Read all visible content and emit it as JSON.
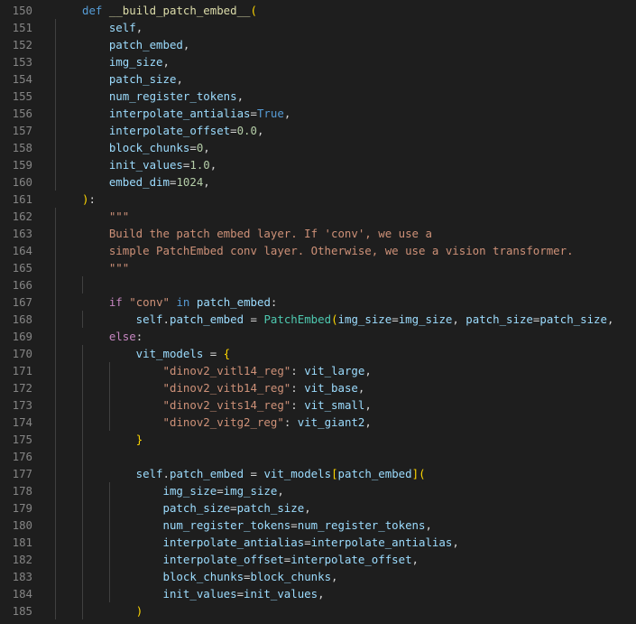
{
  "editor": {
    "lines": [
      {
        "n": "150",
        "tokens": [
          {
            "t": "def",
            "c": "kw"
          },
          {
            "t": " ",
            "c": "pl"
          },
          {
            "t": "__build_patch_embed__",
            "c": "fn"
          },
          {
            "t": "(",
            "c": "b1"
          }
        ]
      },
      {
        "n": "151",
        "tokens": [
          {
            "t": "    self",
            "c": "var"
          },
          {
            "t": ",",
            "c": "pl"
          }
        ]
      },
      {
        "n": "152",
        "tokens": [
          {
            "t": "    patch_embed",
            "c": "var"
          },
          {
            "t": ",",
            "c": "pl"
          }
        ]
      },
      {
        "n": "153",
        "tokens": [
          {
            "t": "    img_size",
            "c": "var"
          },
          {
            "t": ",",
            "c": "pl"
          }
        ]
      },
      {
        "n": "154",
        "tokens": [
          {
            "t": "    patch_size",
            "c": "var"
          },
          {
            "t": ",",
            "c": "pl"
          }
        ]
      },
      {
        "n": "155",
        "tokens": [
          {
            "t": "    num_register_tokens",
            "c": "var"
          },
          {
            "t": ",",
            "c": "pl"
          }
        ]
      },
      {
        "n": "156",
        "tokens": [
          {
            "t": "    interpolate_antialias",
            "c": "var"
          },
          {
            "t": "=",
            "c": "op"
          },
          {
            "t": "True",
            "c": "kw"
          },
          {
            "t": ",",
            "c": "pl"
          }
        ]
      },
      {
        "n": "157",
        "tokens": [
          {
            "t": "    interpolate_offset",
            "c": "var"
          },
          {
            "t": "=",
            "c": "op"
          },
          {
            "t": "0.0",
            "c": "num"
          },
          {
            "t": ",",
            "c": "pl"
          }
        ]
      },
      {
        "n": "158",
        "tokens": [
          {
            "t": "    block_chunks",
            "c": "var"
          },
          {
            "t": "=",
            "c": "op"
          },
          {
            "t": "0",
            "c": "num"
          },
          {
            "t": ",",
            "c": "pl"
          }
        ]
      },
      {
        "n": "159",
        "tokens": [
          {
            "t": "    init_values",
            "c": "var"
          },
          {
            "t": "=",
            "c": "op"
          },
          {
            "t": "1.0",
            "c": "num"
          },
          {
            "t": ",",
            "c": "pl"
          }
        ]
      },
      {
        "n": "160",
        "tokens": [
          {
            "t": "    embed_dim",
            "c": "var"
          },
          {
            "t": "=",
            "c": "op"
          },
          {
            "t": "1024",
            "c": "num"
          },
          {
            "t": ",",
            "c": "pl"
          }
        ]
      },
      {
        "n": "161",
        "tokens": [
          {
            "t": ")",
            "c": "b1"
          },
          {
            "t": ":",
            "c": "pl"
          }
        ]
      },
      {
        "n": "162",
        "tokens": [
          {
            "t": "    \"\"\"",
            "c": "str"
          }
        ]
      },
      {
        "n": "163",
        "tokens": [
          {
            "t": "    Build the patch embed layer. If 'conv', we use a",
            "c": "str"
          }
        ]
      },
      {
        "n": "164",
        "tokens": [
          {
            "t": "    simple PatchEmbed conv layer. Otherwise, we use a vision transformer.",
            "c": "str"
          }
        ]
      },
      {
        "n": "165",
        "tokens": [
          {
            "t": "    \"\"\"",
            "c": "str"
          }
        ]
      },
      {
        "n": "166",
        "tokens": []
      },
      {
        "n": "167",
        "tokens": [
          {
            "t": "    ",
            "c": "pl"
          },
          {
            "t": "if",
            "c": "ctl"
          },
          {
            "t": " ",
            "c": "pl"
          },
          {
            "t": "\"conv\"",
            "c": "str"
          },
          {
            "t": " ",
            "c": "pl"
          },
          {
            "t": "in",
            "c": "kw"
          },
          {
            "t": " ",
            "c": "pl"
          },
          {
            "t": "patch_embed",
            "c": "var"
          },
          {
            "t": ":",
            "c": "pl"
          }
        ]
      },
      {
        "n": "168",
        "tokens": [
          {
            "t": "        self",
            "c": "var"
          },
          {
            "t": ".",
            "c": "pl"
          },
          {
            "t": "patch_embed",
            "c": "var"
          },
          {
            "t": " = ",
            "c": "op"
          },
          {
            "t": "PatchEmbed",
            "c": "cls"
          },
          {
            "t": "(",
            "c": "b1"
          },
          {
            "t": "img_size",
            "c": "var"
          },
          {
            "t": "=",
            "c": "op"
          },
          {
            "t": "img_size",
            "c": "var"
          },
          {
            "t": ", ",
            "c": "pl"
          },
          {
            "t": "patch_size",
            "c": "var"
          },
          {
            "t": "=",
            "c": "op"
          },
          {
            "t": "patch_size",
            "c": "var"
          },
          {
            "t": ",",
            "c": "pl"
          }
        ]
      },
      {
        "n": "169",
        "tokens": [
          {
            "t": "    ",
            "c": "pl"
          },
          {
            "t": "else",
            "c": "ctl"
          },
          {
            "t": ":",
            "c": "pl"
          }
        ]
      },
      {
        "n": "170",
        "tokens": [
          {
            "t": "        vit_models",
            "c": "var"
          },
          {
            "t": " = ",
            "c": "op"
          },
          {
            "t": "{",
            "c": "b1"
          }
        ]
      },
      {
        "n": "171",
        "tokens": [
          {
            "t": "            ",
            "c": "pl"
          },
          {
            "t": "\"dinov2_vitl14_reg\"",
            "c": "str"
          },
          {
            "t": ": ",
            "c": "pl"
          },
          {
            "t": "vit_large",
            "c": "var"
          },
          {
            "t": ",",
            "c": "pl"
          }
        ]
      },
      {
        "n": "172",
        "tokens": [
          {
            "t": "            ",
            "c": "pl"
          },
          {
            "t": "\"dinov2_vitb14_reg\"",
            "c": "str"
          },
          {
            "t": ": ",
            "c": "pl"
          },
          {
            "t": "vit_base",
            "c": "var"
          },
          {
            "t": ",",
            "c": "pl"
          }
        ]
      },
      {
        "n": "173",
        "tokens": [
          {
            "t": "            ",
            "c": "pl"
          },
          {
            "t": "\"dinov2_vits14_reg\"",
            "c": "str"
          },
          {
            "t": ": ",
            "c": "pl"
          },
          {
            "t": "vit_small",
            "c": "var"
          },
          {
            "t": ",",
            "c": "pl"
          }
        ]
      },
      {
        "n": "174",
        "tokens": [
          {
            "t": "            ",
            "c": "pl"
          },
          {
            "t": "\"dinov2_vitg2_reg\"",
            "c": "str"
          },
          {
            "t": ": ",
            "c": "pl"
          },
          {
            "t": "vit_giant2",
            "c": "var"
          },
          {
            "t": ",",
            "c": "pl"
          }
        ]
      },
      {
        "n": "175",
        "tokens": [
          {
            "t": "        ",
            "c": "pl"
          },
          {
            "t": "}",
            "c": "b1"
          }
        ]
      },
      {
        "n": "176",
        "tokens": []
      },
      {
        "n": "177",
        "tokens": [
          {
            "t": "        self",
            "c": "var"
          },
          {
            "t": ".",
            "c": "pl"
          },
          {
            "t": "patch_embed",
            "c": "var"
          },
          {
            "t": " = ",
            "c": "op"
          },
          {
            "t": "vit_models",
            "c": "var"
          },
          {
            "t": "[",
            "c": "b1"
          },
          {
            "t": "patch_embed",
            "c": "var"
          },
          {
            "t": "]",
            "c": "b1"
          },
          {
            "t": "(",
            "c": "b1"
          }
        ]
      },
      {
        "n": "178",
        "tokens": [
          {
            "t": "            img_size",
            "c": "var"
          },
          {
            "t": "=",
            "c": "op"
          },
          {
            "t": "img_size",
            "c": "var"
          },
          {
            "t": ",",
            "c": "pl"
          }
        ]
      },
      {
        "n": "179",
        "tokens": [
          {
            "t": "            patch_size",
            "c": "var"
          },
          {
            "t": "=",
            "c": "op"
          },
          {
            "t": "patch_size",
            "c": "var"
          },
          {
            "t": ",",
            "c": "pl"
          }
        ]
      },
      {
        "n": "180",
        "tokens": [
          {
            "t": "            num_register_tokens",
            "c": "var"
          },
          {
            "t": "=",
            "c": "op"
          },
          {
            "t": "num_register_tokens",
            "c": "var"
          },
          {
            "t": ",",
            "c": "pl"
          }
        ]
      },
      {
        "n": "181",
        "tokens": [
          {
            "t": "            interpolate_antialias",
            "c": "var"
          },
          {
            "t": "=",
            "c": "op"
          },
          {
            "t": "interpolate_antialias",
            "c": "var"
          },
          {
            "t": ",",
            "c": "pl"
          }
        ]
      },
      {
        "n": "182",
        "tokens": [
          {
            "t": "            interpolate_offset",
            "c": "var"
          },
          {
            "t": "=",
            "c": "op"
          },
          {
            "t": "interpolate_offset",
            "c": "var"
          },
          {
            "t": ",",
            "c": "pl"
          }
        ]
      },
      {
        "n": "183",
        "tokens": [
          {
            "t": "            block_chunks",
            "c": "var"
          },
          {
            "t": "=",
            "c": "op"
          },
          {
            "t": "block_chunks",
            "c": "var"
          },
          {
            "t": ",",
            "c": "pl"
          }
        ]
      },
      {
        "n": "184",
        "tokens": [
          {
            "t": "            init_values",
            "c": "var"
          },
          {
            "t": "=",
            "c": "op"
          },
          {
            "t": "init_values",
            "c": "var"
          },
          {
            "t": ",",
            "c": "pl"
          }
        ]
      },
      {
        "n": "185",
        "tokens": [
          {
            "t": "        ",
            "c": "pl"
          },
          {
            "t": ")",
            "c": "b1"
          }
        ]
      }
    ]
  },
  "colors": {
    "background": "#1e1e1e",
    "line_number": "#858585",
    "keyword": "#569cd6",
    "control_keyword": "#c586c0",
    "function": "#dcdcaa",
    "variable": "#9cdcfe",
    "number": "#b5cea8",
    "class": "#4ec9b0",
    "string": "#ce9178",
    "bracket": "#ffd700"
  }
}
